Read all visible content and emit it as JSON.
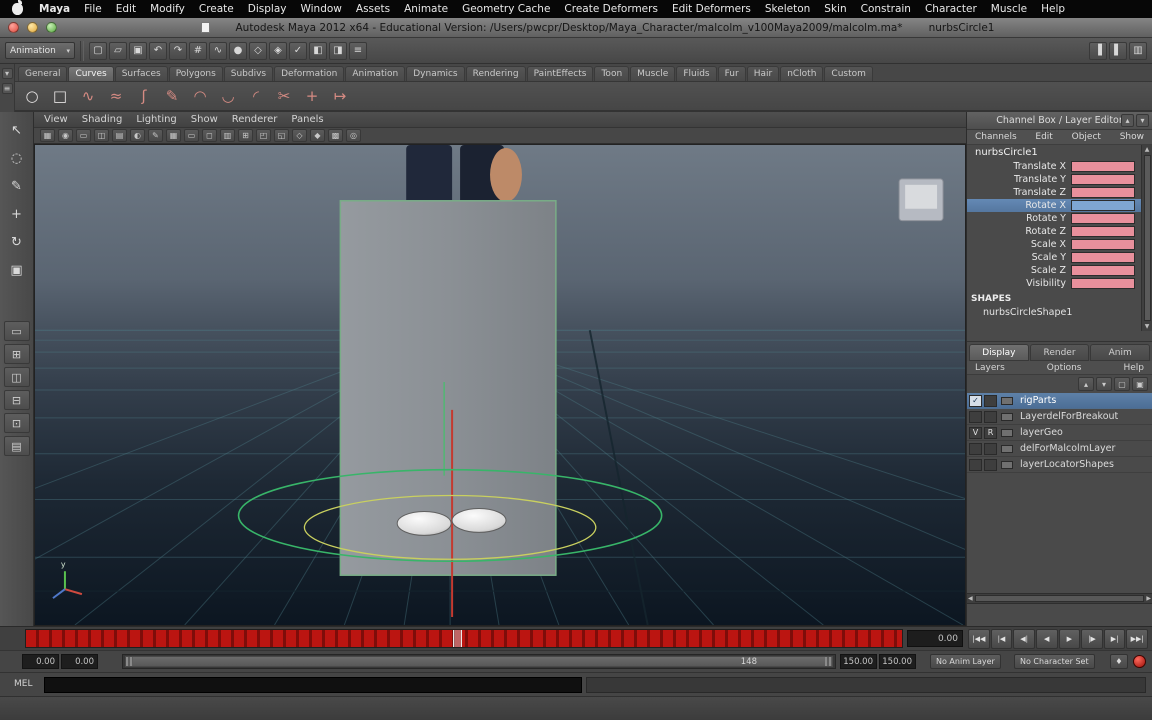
{
  "macos_menubar": {
    "items": [
      "Maya",
      "File",
      "Edit",
      "Modify",
      "Create",
      "Display",
      "Window",
      "Assets",
      "Animate",
      "Geometry Cache",
      "Create Deformers",
      "Edit Deformers",
      "Skeleton",
      "Skin",
      "Constrain",
      "Character",
      "Muscle",
      "Help"
    ]
  },
  "titlebar": {
    "title": "Autodesk Maya 2012 x64 - Educational Version: /Users/pwcpr/Desktop/Maya_Character/malcolm_v100Maya2009/malcolm.ma*",
    "document_context": "nurbsCircle1"
  },
  "status_line": {
    "menu_set": "Animation",
    "icons": [
      {
        "icon_name": "new-scene-icon",
        "glyph": "▢"
      },
      {
        "icon_name": "open-scene-icon",
        "glyph": "▱"
      },
      {
        "icon_name": "save-scene-icon",
        "glyph": "▣"
      },
      {
        "icon_name": "undo-icon",
        "glyph": "↶"
      },
      {
        "icon_name": "redo-icon",
        "glyph": "↷"
      },
      {
        "icon_name": "snap-to-grid-icon",
        "glyph": "#"
      },
      {
        "icon_name": "snap-to-curves-icon",
        "glyph": "∿"
      },
      {
        "icon_name": "snap-to-points-icon",
        "glyph": "●"
      },
      {
        "icon_name": "snap-to-planes-icon",
        "glyph": "◇"
      },
      {
        "icon_name": "make-live-icon",
        "glyph": "◈"
      },
      {
        "icon_name": "construction-history-icon",
        "glyph": "✓"
      },
      {
        "icon_name": "render-current-frame-icon",
        "glyph": "◧"
      },
      {
        "icon_name": "ipr-render-icon",
        "glyph": "◨"
      },
      {
        "icon_name": "render-settings-icon",
        "glyph": "≡"
      }
    ],
    "right_icons": [
      {
        "icon_name": "toggle-attribute-editor-icon",
        "glyph": "▐"
      },
      {
        "icon_name": "toggle-tool-settings-icon",
        "glyph": "▌"
      },
      {
        "icon_name": "toggle-channel-box-icon",
        "glyph": "▥"
      }
    ]
  },
  "shelf": {
    "side_buttons": [
      {
        "icon_name": "shelf-tab-selector-icon",
        "glyph": "▾"
      },
      {
        "icon_name": "shelf-menu-icon",
        "glyph": "≡"
      }
    ],
    "tabs": [
      {
        "label": "General"
      },
      {
        "label": "Curves",
        "state": "active"
      },
      {
        "label": "Surfaces"
      },
      {
        "label": "Polygons"
      },
      {
        "label": "Subdivs"
      },
      {
        "label": "Deformation"
      },
      {
        "label": "Animation"
      },
      {
        "label": "Dynamics"
      },
      {
        "label": "Rendering"
      },
      {
        "label": "PaintEffects"
      },
      {
        "label": "Toon"
      },
      {
        "label": "Muscle"
      },
      {
        "label": "Fluids"
      },
      {
        "label": "Fur"
      },
      {
        "label": "Hair"
      },
      {
        "label": "nCloth"
      },
      {
        "label": "Custom"
      }
    ],
    "icons": [
      {
        "icon_name": "nurbs-circle-icon",
        "glyph": "○"
      },
      {
        "icon_name": "nurbs-square-icon",
        "glyph": "□"
      },
      {
        "icon_name": "cv-curve-tool-icon",
        "glyph": "∿"
      },
      {
        "icon_name": "ep-curve-tool-icon",
        "glyph": "≈"
      },
      {
        "icon_name": "bezier-curve-tool-icon",
        "glyph": "ʃ"
      },
      {
        "icon_name": "pencil-curve-tool-icon",
        "glyph": "✎"
      },
      {
        "icon_name": "three-point-arc-icon",
        "glyph": "◠"
      },
      {
        "icon_name": "two-point-arc-icon",
        "glyph": "◡"
      },
      {
        "icon_name": "attach-curves-icon",
        "glyph": "◜"
      },
      {
        "icon_name": "detach-curves-icon",
        "glyph": "✂"
      },
      {
        "icon_name": "insert-knot-icon",
        "glyph": "+"
      },
      {
        "icon_name": "extend-curve-icon",
        "glyph": "↦"
      }
    ]
  },
  "toolbox": {
    "tools": [
      {
        "icon_name": "select-tool-icon",
        "glyph": "↖"
      },
      {
        "icon_name": "lasso-select-tool-icon",
        "glyph": "◌"
      },
      {
        "icon_name": "paint-select-tool-icon",
        "glyph": "✎"
      },
      {
        "icon_name": "move-tool-icon",
        "glyph": "+"
      },
      {
        "icon_name": "rotate-tool-icon",
        "glyph": "↻"
      },
      {
        "icon_name": "scale-tool-icon",
        "glyph": "▣"
      }
    ],
    "layouts": [
      {
        "icon_name": "single-pane-layout-icon",
        "glyph": "▭"
      },
      {
        "icon_name": "four-pane-layout-icon",
        "glyph": "⊞"
      },
      {
        "icon_name": "persp-outliner-layout-icon",
        "glyph": "◫"
      },
      {
        "icon_name": "persp-graph-layout-icon",
        "glyph": "⊟"
      },
      {
        "icon_name": "hypershade-persp-layout-icon",
        "glyph": "⊡"
      },
      {
        "icon_name": "persp-split-layout-icon",
        "glyph": "▤"
      }
    ]
  },
  "viewport": {
    "menus": [
      "View",
      "Shading",
      "Lighting",
      "Show",
      "Renderer",
      "Panels"
    ],
    "toolbar_icons": [
      {
        "icon_name": "select-camera-icon",
        "glyph": "▦"
      },
      {
        "icon_name": "lock-camera-icon",
        "glyph": "◉"
      },
      {
        "icon_name": "camera-attributes-icon",
        "glyph": "▭"
      },
      {
        "icon_name": "bookmarks-icon",
        "glyph": "◫"
      },
      {
        "icon_name": "image-plane-icon",
        "glyph": "▤"
      },
      {
        "icon_name": "2d-pan-zoom-icon",
        "glyph": "◐"
      },
      {
        "icon_name": "grease-pencil-icon",
        "glyph": "✎"
      },
      {
        "icon_name": "grid-toggle-icon",
        "glyph": "▦"
      },
      {
        "icon_name": "film-gate-icon",
        "glyph": "▭"
      },
      {
        "icon_name": "resolution-gate-icon",
        "glyph": "◻"
      },
      {
        "icon_name": "gate-mask-icon",
        "glyph": "▥"
      },
      {
        "icon_name": "field-chart-icon",
        "glyph": "⊞"
      },
      {
        "icon_name": "safe-action-icon",
        "glyph": "◰"
      },
      {
        "icon_name": "safe-title-icon",
        "glyph": "◱"
      },
      {
        "icon_name": "wireframe-mode-icon",
        "glyph": "◇"
      },
      {
        "icon_name": "shaded-mode-icon",
        "glyph": "◆"
      },
      {
        "icon_name": "textured-mode-icon",
        "glyph": "▩"
      },
      {
        "icon_name": "isolate-select-icon",
        "glyph": "◎"
      }
    ]
  },
  "channel_box": {
    "header": "Channel Box / Layer Editor",
    "header_buttons": [
      {
        "icon_name": "channel-box-collapse-icon",
        "glyph": "▴"
      },
      {
        "icon_name": "layer-editor-expand-icon",
        "glyph": "▾"
      }
    ],
    "menus": [
      "Channels",
      "Edit",
      "Object",
      "Show"
    ],
    "object_name": "nurbsCircle1",
    "channels": [
      {
        "label": "Translate X",
        "value": ""
      },
      {
        "label": "Translate Y",
        "value": ""
      },
      {
        "label": "Translate Z",
        "value": ""
      },
      {
        "label": "Rotate X",
        "value": "",
        "state": "selected"
      },
      {
        "label": "Rotate Y",
        "value": ""
      },
      {
        "label": "Rotate Z",
        "value": ""
      },
      {
        "label": "Scale X",
        "value": ""
      },
      {
        "label": "Scale Y",
        "value": ""
      },
      {
        "label": "Scale Z",
        "value": ""
      },
      {
        "label": "Visibility",
        "value": ""
      }
    ],
    "shapes_header": "SHAPES",
    "shape_name": "nurbsCircleShape1"
  },
  "layer_editor": {
    "tabs": [
      {
        "label": "Display",
        "state": "active"
      },
      {
        "label": "Render"
      },
      {
        "label": "Anim"
      }
    ],
    "menus": [
      "Layers",
      "Options",
      "Help"
    ],
    "toolbar_icons": [
      {
        "icon_name": "move-layer-up-icon",
        "glyph": "▴"
      },
      {
        "icon_name": "move-layer-down-icon",
        "glyph": "▾"
      },
      {
        "icon_name": "create-empty-layer-icon",
        "glyph": "▢"
      },
      {
        "icon_name": "create-layer-from-selected-icon",
        "glyph": "▣"
      }
    ],
    "layers": [
      {
        "name": "rigParts",
        "v": "✓",
        "t": "",
        "state": "selected"
      },
      {
        "name": "LayerdelForBreakout",
        "v": "",
        "t": ""
      },
      {
        "name": "layerGeo",
        "v": "V",
        "t": "R"
      },
      {
        "name": "delForMalcolmLayer",
        "v": "",
        "t": ""
      },
      {
        "name": "layerLocatorShapes",
        "v": "",
        "t": ""
      }
    ]
  },
  "timeline": {
    "current_time": "0.00",
    "playback_buttons": [
      {
        "icon_name": "go-to-playback-start-button",
        "glyph": "|◀◀"
      },
      {
        "icon_name": "step-back-frame-button",
        "glyph": "|◀"
      },
      {
        "icon_name": "step-back-key-button",
        "glyph": "◀|"
      },
      {
        "icon_name": "play-backwards-button",
        "glyph": "◀"
      },
      {
        "icon_name": "play-forwards-button",
        "glyph": "▶"
      },
      {
        "icon_name": "step-forward-key-button",
        "glyph": "|▶"
      },
      {
        "icon_name": "step-forward-frame-button",
        "glyph": "▶|"
      },
      {
        "icon_name": "go-to-playback-end-button",
        "glyph": "▶▶|"
      }
    ]
  },
  "range_slider": {
    "anim_start": "0.00",
    "playback_start": "0.00",
    "handle_label": "148",
    "playback_end": "150.00",
    "anim_end": "150.00",
    "anim_layer_button": "No Anim Layer",
    "character_set_button": "No Character Set",
    "set_key_glyph": "♦"
  },
  "command_line": {
    "label": "MEL",
    "value": ""
  },
  "help_line": {
    "text": ""
  },
  "colors": {
    "keyframe_red": "#b21311",
    "channel_keyed_pink": "#e8909c",
    "selection_blue": "#5b7ea8",
    "nurbs_selection_green": "#38b569"
  }
}
